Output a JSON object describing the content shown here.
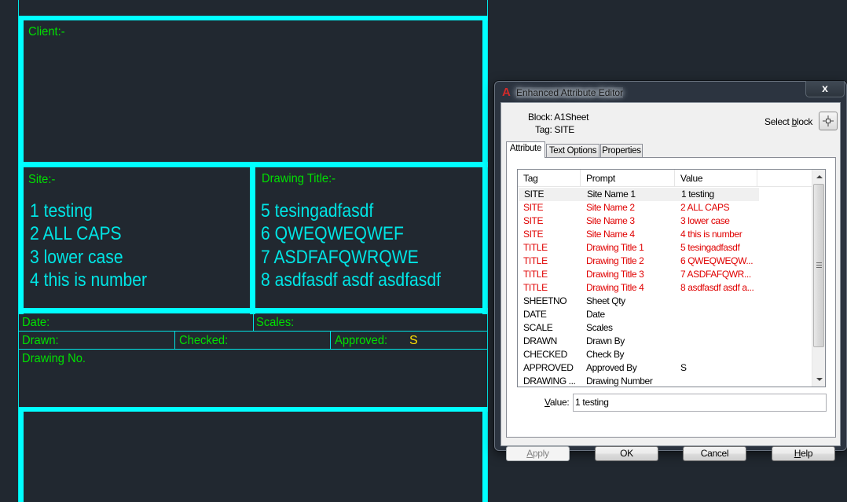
{
  "cad": {
    "client_label": "Client:-",
    "site_label": "Site:-",
    "site_values": [
      "1 testing",
      "2 ALL CAPS",
      "3 lower case",
      "4 this is number"
    ],
    "drawing_title_label": "Drawing Title:-",
    "drawing_title_values": [
      "5 tesingadfasdf",
      "6 QWEQWEQWEF",
      "7 ASDFAFQWRQWE",
      "8 asdfasdf asdf asdfasdf"
    ],
    "date_label": "Date:",
    "scales_label": "Scales:",
    "drawn_label": "Drawn:",
    "checked_label": "Checked:",
    "approved_label": "Approved:",
    "approved_value": "S",
    "drawing_no_label": "Drawing No."
  },
  "dialog": {
    "title": "Enhanced Attribute Editor",
    "close_label": "x",
    "block_label": "Block: A1Sheet",
    "tag_label": "Tag: SITE",
    "select_block": {
      "pre": "Select ",
      "hotkey": "b",
      "post": "lock"
    },
    "tabs": [
      {
        "label": "Attribute",
        "active": true
      },
      {
        "label": "Text Options",
        "active": false
      },
      {
        "label": "Properties",
        "active": false
      }
    ],
    "columns": [
      "Tag",
      "Prompt",
      "Value"
    ],
    "rows": [
      {
        "tag": "SITE",
        "prompt": "Site Name 1",
        "value": "1 testing",
        "state": "selected"
      },
      {
        "tag": "SITE",
        "prompt": "Site Name 2",
        "value": "2 ALL CAPS",
        "state": "red"
      },
      {
        "tag": "SITE",
        "prompt": "Site Name 3",
        "value": "3 lower case",
        "state": "red"
      },
      {
        "tag": "SITE",
        "prompt": "Site Name 4",
        "value": "4 this is number",
        "state": "red"
      },
      {
        "tag": "TITLE",
        "prompt": "Drawing Title 1",
        "value": "5 tesingadfasdf",
        "state": "red"
      },
      {
        "tag": "TITLE",
        "prompt": "Drawing Title 2",
        "value": "6 QWEQWEQW...",
        "state": "red"
      },
      {
        "tag": "TITLE",
        "prompt": "Drawing Title 3",
        "value": "7 ASDFAFQWR...",
        "state": "red"
      },
      {
        "tag": "TITLE",
        "prompt": "Drawing Title 4",
        "value": "8 asdfasdf asdf a...",
        "state": "red"
      },
      {
        "tag": "SHEETNO",
        "prompt": "Sheet Qty",
        "value": "",
        "state": "black"
      },
      {
        "tag": "DATE",
        "prompt": "Date",
        "value": "",
        "state": "black"
      },
      {
        "tag": "SCALE",
        "prompt": "Scales",
        "value": "",
        "state": "black"
      },
      {
        "tag": "DRAWN",
        "prompt": "Drawn By",
        "value": "",
        "state": "black"
      },
      {
        "tag": "CHECKED",
        "prompt": "Check By",
        "value": "",
        "state": "black"
      },
      {
        "tag": "APPROVED",
        "prompt": "Approved By",
        "value": "S",
        "state": "black"
      },
      {
        "tag": "DRAWING ...",
        "prompt": "Drawing Number",
        "value": "",
        "state": "black"
      }
    ],
    "value_label": {
      "hotkey": "V",
      "rest": "alue:"
    },
    "value_input": "1 testing",
    "buttons": {
      "apply": {
        "hotkey": "A",
        "rest": "pply",
        "disabled": true
      },
      "ok": "OK",
      "cancel": "Cancel",
      "help": {
        "hotkey": "H",
        "rest": "elp"
      }
    }
  },
  "colors": {
    "cad_background": "#212830",
    "cad_lines": "#00ffff",
    "cad_label_text": "#00e000",
    "cad_value_text": "#00e5e5",
    "cad_yellow_text": "#ffe000",
    "modified_row_text": "#e00000"
  }
}
